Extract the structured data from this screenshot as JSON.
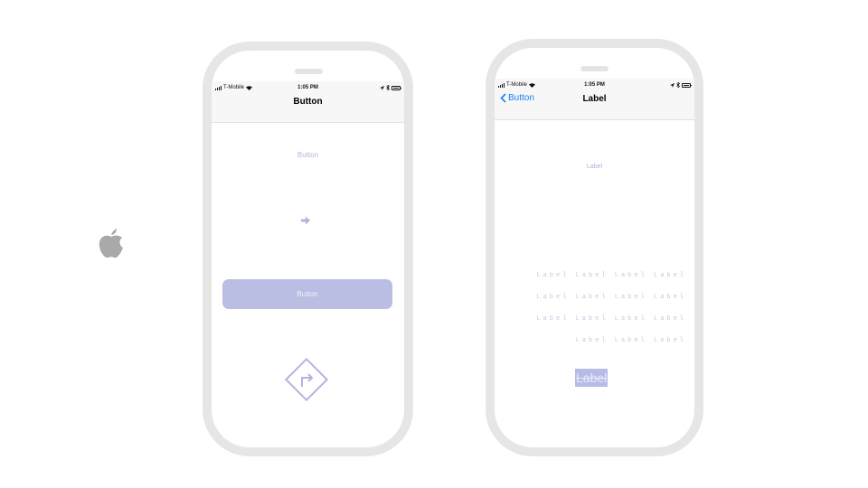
{
  "icons": {
    "brand": "apple-icon",
    "wifi": "wifi-icon",
    "bluetooth": "bluetooth-icon",
    "location": "location-icon",
    "battery": "battery-icon",
    "arrow": "arrow-right-icon",
    "turn_sign": "turn-right-sign-icon",
    "back": "chevron-left-icon"
  },
  "colors": {
    "accent": "#b9bee2",
    "faint_text": "#b3b3df",
    "ios_blue": "#1a7cf5"
  },
  "left_phone": {
    "status": {
      "carrier": "T-Mobile",
      "time": "1:05 PM"
    },
    "nav_title": "Button",
    "text_button_label": "Button",
    "wide_button_label": "Button"
  },
  "right_phone": {
    "status": {
      "carrier": "T-Mobile",
      "time": "1:05 PM"
    },
    "back_label": "Button",
    "nav_title": "Label",
    "small_label": "Label",
    "label_lines": [
      "Label Label Label Label",
      "Label Label Label Label",
      "Label Label Label Label",
      "Label Label Label"
    ],
    "highlight_label": "Label"
  }
}
